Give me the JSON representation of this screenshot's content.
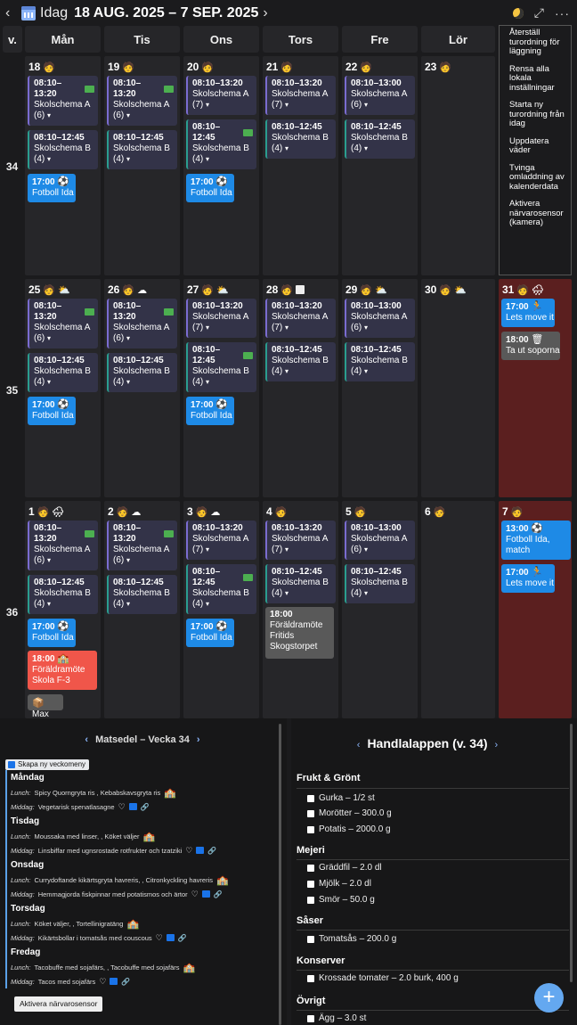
{
  "header": {
    "today_label": "Idag",
    "date_range": "18 AUG. 2025 – 7 SEP. 2025",
    "prev_icon": "chevron-left-icon",
    "next_icon": "chevron-right-icon",
    "theme_icon": "moon-icon",
    "expand_icon": "expand-icon",
    "more_icon": "more-icon"
  },
  "columns": {
    "week": "v.",
    "mon": "Mån",
    "tue": "Tis",
    "wed": "Ons",
    "thu": "Tors",
    "fri": "Fre",
    "sat": "Lör"
  },
  "weeks": [
    "34",
    "35",
    "36"
  ],
  "days": {
    "w1": [
      "18",
      "19",
      "20",
      "21",
      "22",
      "23"
    ],
    "w2": [
      "25",
      "26",
      "27",
      "28",
      "29",
      "30",
      "31"
    ],
    "w3": [
      "1",
      "2",
      "3",
      "4",
      "5",
      "6",
      "7"
    ]
  },
  "events": {
    "t1013": "08:10–\n13:20",
    "t1013b": "08:10–13:20",
    "t1245": "08:10–12:45",
    "t1245n": "08:10–\n12:45",
    "t1300": "08:10–13:00",
    "schA": "Skolschema A",
    "schB": "Skolschema B",
    "c6": "(6)",
    "c7": "(7)",
    "c4": "(4)",
    "caret": "▾",
    "fotboll_time": "17:00",
    "fotboll": "Fotboll Ida",
    "move_time": "17:00",
    "move": "Lets move it",
    "sop_time": "18:00",
    "sop": "Ta ut soporna",
    "fm_time": "13:00",
    "fm": "Fotboll Ida, match",
    "par_time": "18:00",
    "par": "Föräldramöte Skola F-3",
    "par2_time": "18:00",
    "par2": "Föräldramöte Fritids Skogstorpet",
    "max": "Max"
  },
  "menu": [
    "Återställ turordning för läggning",
    "Rensa alla lokala inställningar",
    "Starta ny turordning från idag",
    "Uppdatera väder",
    "Tvinga omladdning av kalenderdata",
    "Aktivera närvarosensor (kamera)"
  ],
  "mealplan": {
    "title": "Matsedel – Vecka 34",
    "create": "Skapa ny veckomeny",
    "lunch": "Lunch:",
    "dinner": "Middag:",
    "days": [
      {
        "name": "Måndag",
        "lunch": "Spicy Quorngryta ris , Kebabskavsgryta ris",
        "dinner": "Vegetarisk spenatlasagne"
      },
      {
        "name": "Tisdag",
        "lunch": "Moussaka med linser, , Köket väljer",
        "dinner": "Linsbiffar med ugnsrostade rotfrukter och tzatziki"
      },
      {
        "name": "Onsdag",
        "lunch": "Currydoftande kikärtsgryta havreris, , Citronkyckling havreris",
        "dinner": "Hemmagjorda fiskpinnar med potatismos och ärtor"
      },
      {
        "name": "Torsdag",
        "lunch": "Köket väljer, , Tortellinigratäng",
        "dinner": "Kikärtsbollar i tomatsås med couscous"
      },
      {
        "name": "Fredag",
        "lunch": "Tacobuffe med sojafärs, , Tacobuffe med sojafärs",
        "dinner": "Tacos med sojafärs"
      }
    ]
  },
  "shopping": {
    "title": "Handlalappen (v. 34)",
    "cats": [
      {
        "name": "Frukt & Grönt",
        "items": [
          "Gurka – 1/2 st",
          "Morötter – 300.0 g",
          "Potatis – 2000.0 g"
        ]
      },
      {
        "name": "Mejeri",
        "items": [
          "Gräddfil – 2.0 dl",
          "Mjölk – 2.0 dl",
          "Smör – 50.0 g"
        ]
      },
      {
        "name": "Såser",
        "items": [
          "Tomatsås – 200.0 g"
        ]
      },
      {
        "name": "Konserver",
        "items": [
          "Krossade tomater – 2.0 burk, 400 g"
        ]
      },
      {
        "name": "Övrigt",
        "items": [
          "Ägg – 3.0 st"
        ]
      }
    ]
  },
  "toast": "Aktivera närvarosensor",
  "fab": "+"
}
